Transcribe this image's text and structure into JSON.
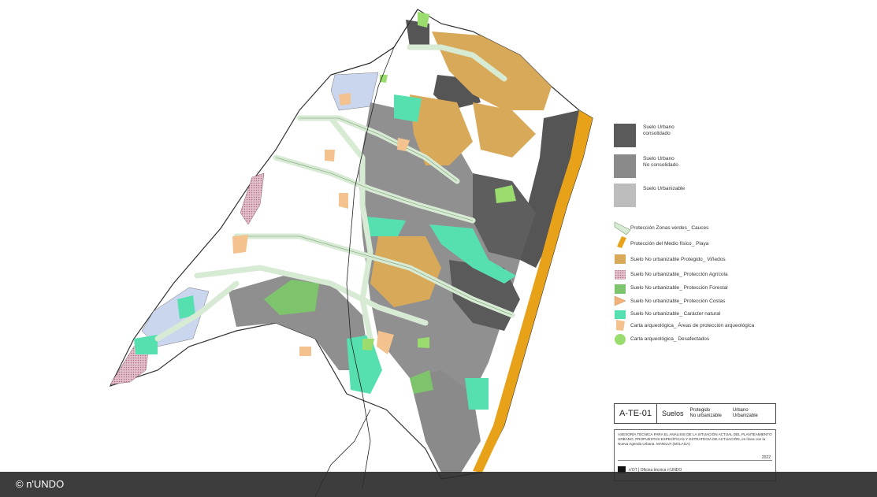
{
  "colors": {
    "urbano_consolidado": "#5a5a5a",
    "urbano_no_consolidado": "#8a8a8a",
    "urbanizable": "#bdbdbd",
    "zonas_verdes": "#d7ead3",
    "playa": "#e8a21a",
    "vinedos": "#d9a95a",
    "agricola": "#d6a6b5",
    "forestal": "#7dc46d",
    "costas": "#f0b27a",
    "caracter_natural": "#56e0b0",
    "arqueo_areas": "#f3c28e",
    "arqueo_desafectados": "#9bdc6e",
    "blue_area": "#c9d6ee"
  },
  "legend": {
    "items": [
      {
        "label": "Suelo Urbano\nconsolidado",
        "swatch": "urbano_consolidado",
        "icon": "square-swatch"
      },
      {
        "label": "Suelo Urbano\nNo consolidado",
        "swatch": "urbano_no_consolidado",
        "icon": "square-swatch"
      },
      {
        "label": "Suelo Urbanizable",
        "swatch": "urbanizable",
        "icon": "square-swatch"
      },
      {
        "label": "Protección Zonas verdes_ Cauces",
        "swatch": "zonas_verdes",
        "icon": "stream-swatch"
      },
      {
        "label": "Protección del Medio físico_ Playa",
        "swatch": "playa",
        "icon": "beach-swatch"
      },
      {
        "label": "Suelo No urbanizable Protegido_ Viñedos",
        "swatch": "vinedos",
        "icon": "square-swatch"
      },
      {
        "label": "Suelo No urbanizable_ Protección Agrícola",
        "swatch": "agricola",
        "icon": "square-swatch"
      },
      {
        "label": "Suelo No urbanizable_ Protección Forestal",
        "swatch": "forestal",
        "icon": "square-swatch"
      },
      {
        "label": "Suelo No urbanizable_ Protección Costas",
        "swatch": "costas",
        "icon": "square-swatch"
      },
      {
        "label": "Suelo No urbanizable_ Carácter natural",
        "swatch": "caracter_natural",
        "icon": "square-swatch"
      },
      {
        "label": "Carta arqueológica_ Áreas de protección arqueológica",
        "swatch": "arqueo_areas",
        "icon": "blob-swatch"
      },
      {
        "label": "Carta arqueológica_ Desafectados",
        "swatch": "arqueo_desafectados",
        "icon": "blob-swatch"
      }
    ]
  },
  "title_block": {
    "code": "A-TE-01",
    "name": "Suelos",
    "col1": [
      "Protegido",
      "No urbanizable"
    ],
    "col2": [
      "Urbano",
      "Urbanizable"
    ]
  },
  "info": {
    "text": "ASESORÍA TÉCNICA PARA EL ANÁLISIS DE LA SITUACIÓN ACTUAL DEL PLANTEAMIENTO URBANO, PROPUESTAS ESPECÍFICAS Y ESTRATEGIA DE ACTUACIÓN, en línea con la Nueva Agenda Urbana. MANILVA (MÁLAGA)",
    "year": "2022",
    "office": "n'OT | Oficina técnica n'UNDO"
  },
  "footer": {
    "credit": "© n'UNDO"
  }
}
